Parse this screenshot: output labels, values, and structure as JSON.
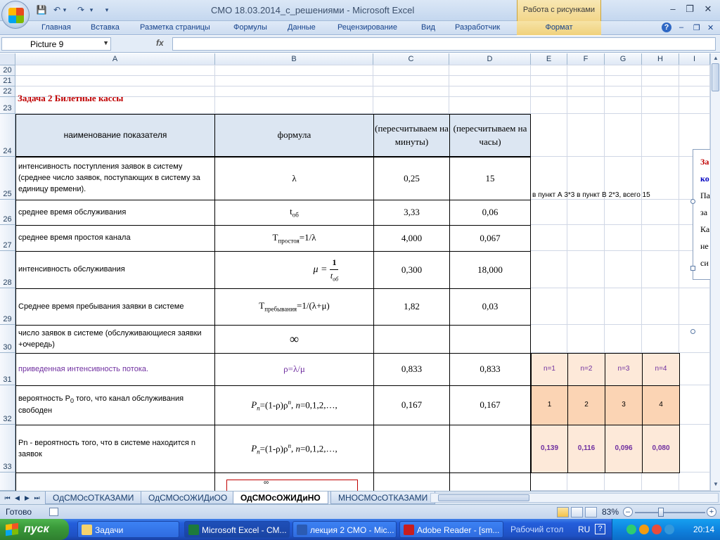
{
  "window": {
    "title": "СМО 18.03.2014_с_решениями - Microsoft Excel",
    "context_group": "Работа с рисунками",
    "controls": {
      "minimize": "–",
      "maximize": "❐",
      "close": "✕"
    },
    "qat": {
      "save": "💾",
      "undo": "↶",
      "redo": "↷",
      "more": "▾"
    }
  },
  "ribbon": {
    "tabs": [
      "Главная",
      "Вставка",
      "Разметка страницы",
      "Формулы",
      "Данные",
      "Рецензирование",
      "Вид",
      "Разработчик"
    ],
    "context_tab": "Формат",
    "help": "?",
    "doc_controls": {
      "minimize": "–",
      "restore": "❐",
      "close": "✕"
    }
  },
  "formula_bar": {
    "name_box": "Picture 9",
    "fx": "fx",
    "value": ""
  },
  "grid": {
    "columns": [
      "A",
      "B",
      "C",
      "D",
      "E",
      "F",
      "G",
      "H",
      "I"
    ],
    "rows": [
      "20",
      "21",
      "22",
      "23",
      "24",
      "25",
      "26",
      "27",
      "28",
      "29",
      "30",
      "31",
      "32",
      "33"
    ],
    "task_title": "Задача 2 Билетные кассы",
    "headers": {
      "name": "наименование показателя",
      "formula": "формула",
      "minutes": "(пересчитываем на минуты)",
      "hours": "(пересчитываем на часы)"
    },
    "table": [
      {
        "name": "интенсивность поступления заявок в систему (среднее число заявок, поступающих в систему за единицу времени).",
        "formula": "λ",
        "c": "0,25",
        "d": "15"
      },
      {
        "name": "среднее время обслуживания",
        "formula": "tоб",
        "c": "3,33",
        "d": "0,06"
      },
      {
        "name": "среднее время простоя канала",
        "formula": "Tпростоя=1/λ",
        "c": "4,000",
        "d": "0,067"
      },
      {
        "name": "интенсивность обслуживания",
        "formula": "μ = 1 / tоб",
        "c": "0,300",
        "d": "18,000"
      },
      {
        "name": "Среднее время пребывания заявки в системе",
        "formula": "Tпребывания=1/(λ+μ)",
        "c": "1,82",
        "d": "0,03"
      },
      {
        "name": "число заявок в системе (обслуживающиеся заявки +очередь)",
        "formula": "∞",
        "c": "",
        "d": ""
      },
      {
        "name": "приведенная интенсивность потока.",
        "formula": "ρ=λ/μ",
        "c": "0,833",
        "d": "0,833"
      },
      {
        "name": "вероятность P0 того, что канал обслуживания свободен",
        "formula": "Pn=(1-ρ)ρn, n=0,1,2,…,",
        "c": "0,167",
        "d": "0,167"
      },
      {
        "name": "Pn - вероятность того, что в системе находится n заявок",
        "formula": "Pn=(1-ρ)ρn, n=0,1,2,…,",
        "c": "",
        "d": ""
      }
    ],
    "note_row25": "в пункт А 3*3 в пункт В 2*3, всего 15",
    "n_labels": [
      "n=1",
      "n=2",
      "n=3",
      "n=4"
    ],
    "n_values": [
      "1",
      "2",
      "3",
      "4"
    ],
    "p_values": [
      "0,139",
      "0,116",
      "0,096",
      "0,080"
    ],
    "textbox_lines": [
      "За",
      "ко",
      "Па",
      "за",
      "Ка",
      "не",
      "си"
    ],
    "formula34_sup": "∞"
  },
  "sheets": {
    "tabs": [
      "ОдСМОсОТКАЗАМИ",
      "ОдСМОсОЖИДиОО",
      "ОдСМОсОЖИДиНО",
      "МНОСМОсОТКАЗАМИ"
    ],
    "active": 2
  },
  "status": {
    "ready": "Готово",
    "zoom": "83%"
  },
  "taskbar": {
    "start": "пуск",
    "buttons": [
      "Задачи",
      "Microsoft Excel - СМ...",
      "лекция 2 СМО - Mic...",
      "Adobe Reader - [sm..."
    ],
    "desktop": "Рабочий стол",
    "lang": "RU",
    "time": "20:14"
  }
}
